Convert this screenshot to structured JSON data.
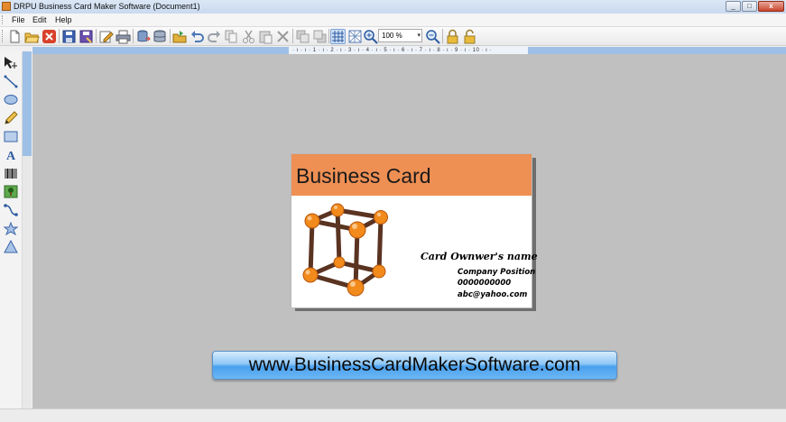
{
  "window": {
    "title": "DRPU Business Card Maker Software  (Document1)",
    "minimize": "_",
    "maximize": "□",
    "close": "x"
  },
  "menu": [
    "File",
    "Edit",
    "Help"
  ],
  "toolbar": {
    "zoom_value": "100 %",
    "icons": [
      "new-icon",
      "open-icon",
      "close-doc-icon",
      "save-icon",
      "save-as-icon",
      "edit-icon",
      "print-icon",
      "export-icon",
      "database-icon",
      "folder-open-icon",
      "undo-icon",
      "redo-icon",
      "copy-icon",
      "cut-icon",
      "paste-icon",
      "delete-icon",
      "bring-forward-icon",
      "send-backward-icon",
      "grid-icon",
      "pattern-icon",
      "zoom-in-icon",
      "zoom-out-icon",
      "lock-icon",
      "unlock-icon"
    ]
  },
  "left_tools": [
    "pointer-icon",
    "line-icon",
    "ellipse-icon",
    "pencil-icon",
    "rectangle-icon",
    "text-icon",
    "barcode-icon",
    "image-icon",
    "curve-icon",
    "star-icon",
    "triangle-icon"
  ],
  "ruler": {
    "labels": "· ı · ı · 1 · ı · 2 · ı · 3 · ı · 4 · ı · 5 · ı · 6 · ı · 7 · ı · 8 · ı · 9 · ı · 10 · ı ·"
  },
  "card": {
    "title": "Business Card",
    "owner": "Card Ownwer's name",
    "position": "Company Position",
    "phone": "0000000000",
    "email": "abc@yahoo.com",
    "header_color": "#ee8f54",
    "image": "3d-cube-molecule-icon"
  },
  "banner": {
    "text": "www.BusinessCardMakerSoftware.com"
  }
}
